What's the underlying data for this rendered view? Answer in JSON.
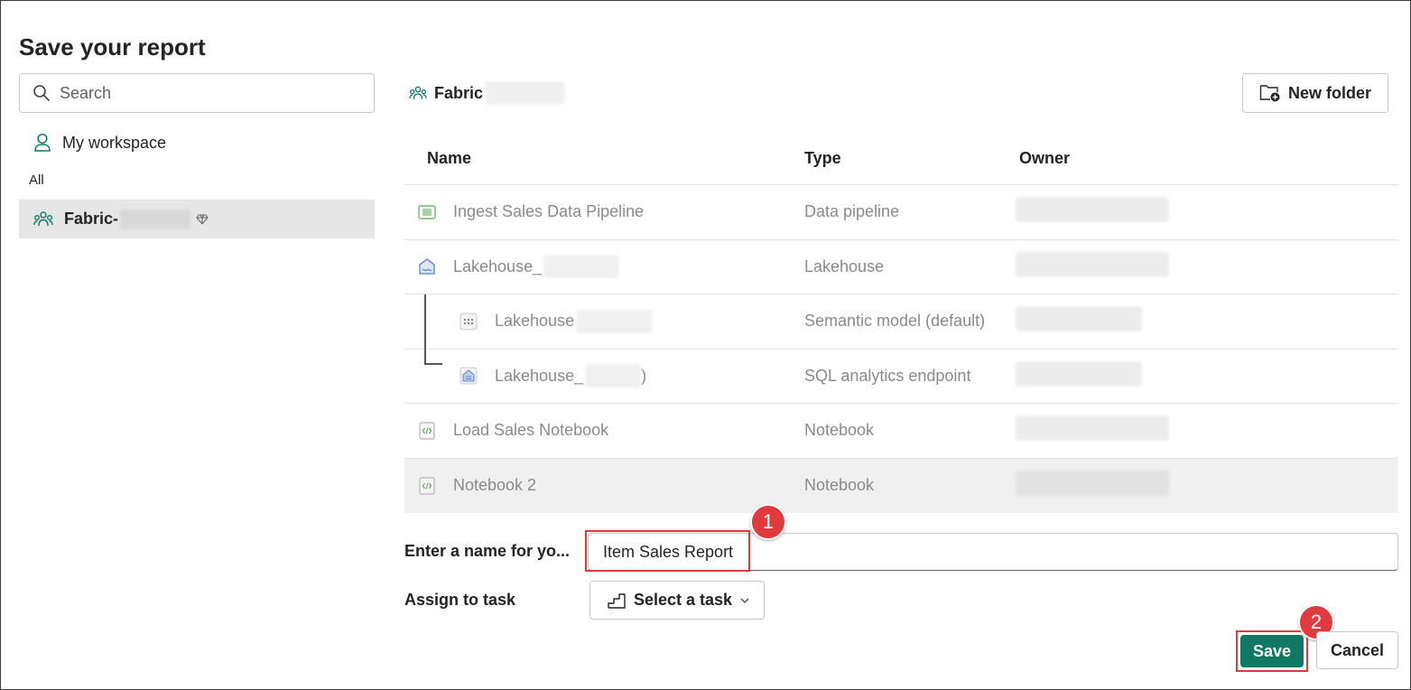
{
  "dialog": {
    "title": "Save your report"
  },
  "sidebar": {
    "search_placeholder": "Search",
    "my_workspace": "My workspace",
    "section_label": "All",
    "workspace_item": "Fabric-"
  },
  "header": {
    "breadcrumb": "Fabric",
    "new_folder": "New folder"
  },
  "table": {
    "columns": [
      "Name",
      "Type",
      "Owner"
    ],
    "rows": [
      {
        "name": "Ingest Sales Data Pipeline",
        "type": "Data pipeline",
        "icon": "pipeline-icon"
      },
      {
        "name": "Lakehouse_",
        "type": "Lakehouse",
        "icon": "lakehouse-icon"
      },
      {
        "name": "Lakehouse",
        "type": "Semantic model (default)",
        "icon": "semantic-model-icon"
      },
      {
        "name": "Lakehouse_",
        "type": "SQL analytics endpoint",
        "icon": "sql-endpoint-icon"
      },
      {
        "name": "Load Sales Notebook",
        "type": "Notebook",
        "icon": "notebook-icon"
      },
      {
        "name": "Notebook 2",
        "type": "Notebook",
        "icon": "notebook-icon"
      }
    ]
  },
  "form": {
    "name_label": "Enter a name for yo...",
    "name_value": "Item Sales Report",
    "task_label": "Assign to task",
    "task_button": "Select a task"
  },
  "actions": {
    "save": "Save",
    "cancel": "Cancel"
  },
  "annotations": {
    "step1": "1",
    "step2": "2"
  },
  "colors": {
    "primary": "#117865",
    "annotation": "#e0393e",
    "selected_row": "#f0f0f0"
  }
}
